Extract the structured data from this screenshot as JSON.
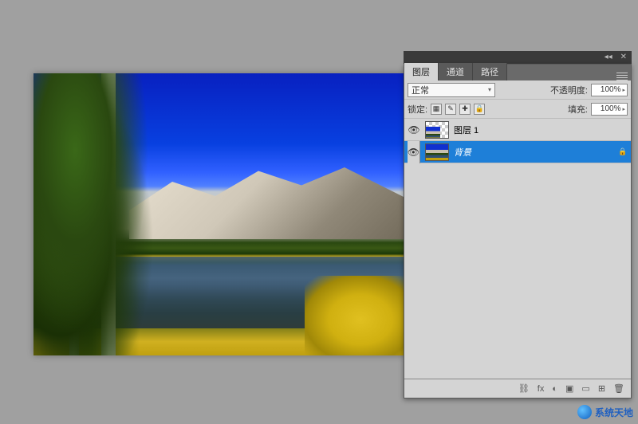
{
  "tabs": {
    "layers": "图层",
    "channels": "通道",
    "paths": "路径"
  },
  "blend": {
    "mode": "正常",
    "opacity_label": "不透明度:",
    "opacity_value": "100%"
  },
  "lock": {
    "label": "锁定:",
    "fill_label": "填充:",
    "fill_value": "100%"
  },
  "layers_list": [
    {
      "name": "图层 1",
      "selected": false,
      "transparent": true,
      "locked": false
    },
    {
      "name": "背景",
      "selected": true,
      "transparent": false,
      "locked": true,
      "italic": true
    }
  ],
  "icons": {
    "eye": "👁",
    "chain": "⛓",
    "fx": "fx",
    "mask": "◐",
    "folder": "▣",
    "new": "⊞",
    "trash": "🗑",
    "brush": "✎",
    "lock": "🔒",
    "plus": "✚",
    "collapse": "◂◂",
    "close": "✕"
  },
  "watermark": "系统天地"
}
